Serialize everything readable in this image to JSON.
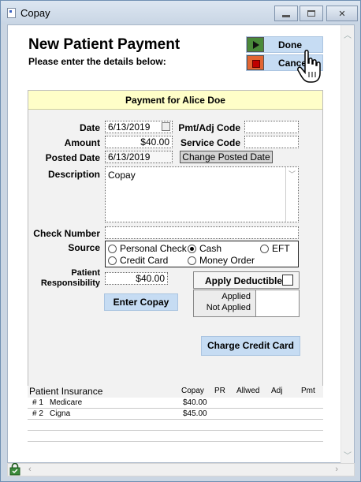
{
  "window": {
    "title": "Copay"
  },
  "header": {
    "title": "New Patient Payment",
    "subtitle": "Please enter the details below:",
    "done_label": "Done",
    "cancel_label": "Cancel"
  },
  "panel": {
    "title": "Payment for Alice Doe",
    "date_label": "Date",
    "date_value": "6/13/2019",
    "amount_label": "Amount",
    "amount_value": "$40.00",
    "posted_date_label": "Posted Date",
    "posted_date_value": "6/13/2019",
    "change_posted_date_label": "Change Posted Date",
    "pmt_adj_code_label": "Pmt/Adj Code",
    "pmt_adj_code_value": "",
    "service_code_label": "Service Code",
    "service_code_value": "",
    "description_label": "Description",
    "description_value": "Copay",
    "check_number_label": "Check Number",
    "check_number_value": "",
    "source_label": "Source",
    "source_options": [
      {
        "label": "Personal Check",
        "selected": false
      },
      {
        "label": "Cash",
        "selected": true
      },
      {
        "label": "EFT",
        "selected": false
      },
      {
        "label": "Credit Card",
        "selected": false
      },
      {
        "label": "Money Order",
        "selected": false
      }
    ],
    "patient_resp_label_1": "Patient",
    "patient_resp_label_2": "Responsibility",
    "patient_resp_value": "$40.00",
    "apply_deductible_label": "Apply Deductible",
    "applied_label": "Applied",
    "not_applied_label": "Not Applied",
    "enter_copay_label": "Enter Copay",
    "charge_credit_card_label": "Charge Credit Card"
  },
  "insurance": {
    "title": "Patient Insurance",
    "columns": [
      "Copay",
      "PR",
      "Allwed",
      "Adj",
      "Pmt"
    ],
    "rows": [
      {
        "num": "# 1",
        "name": "Medicare",
        "copay": "$40.00"
      },
      {
        "num": "# 2",
        "name": "Cigna",
        "copay": "$45.00"
      }
    ]
  },
  "colors": {
    "button_blue": "#c6dcf3",
    "panel_header": "#fffec8",
    "done_icon": "#4a8a3a",
    "cancel_icon": "#e26532"
  }
}
